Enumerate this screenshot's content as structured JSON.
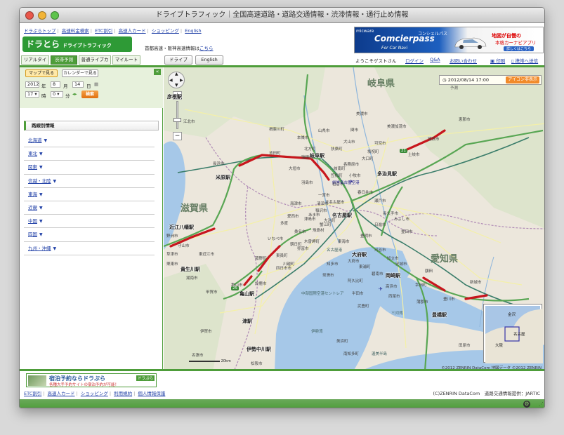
{
  "window": {
    "title": "ドライブトラフィック｜全国高速道路・道路交通情報・渋滞情報・通行止め情報"
  },
  "header": {
    "top_links": [
      "ドラぷらトップ",
      "高速料金検索",
      "ETC割引",
      "高速人カード",
      "ショッピング",
      "English"
    ],
    "logo_main": "ドラとら",
    "logo_sub": "ドライブトラフィック",
    "metro_text": "首都高速・阪神高速情報は",
    "metro_link": "こちら",
    "banner": {
      "brand": "micware",
      "product": "Comcierpass",
      "product_kana": "コンシェルパス",
      "tagline": "For Car Navi",
      "headline": "地図が自慢の",
      "subline": "本格カーナビアプリ",
      "cta": "詳しくはこちら"
    },
    "tabs": [
      "リアルタイム",
      "渋滞予測",
      "普通ライブカメラ",
      "マイルート"
    ],
    "active_tab": "渋滞予測",
    "view_buttons": [
      "ドライブ",
      "English"
    ],
    "greeting": "ようこそゲストさん",
    "user_links": [
      "ログイン",
      "Q&A",
      "お問い合わせ",
      "印刷",
      "携帯へ送信"
    ]
  },
  "sidebar": {
    "btn_map": "マップで見る",
    "btn_calendar": "カレンダーで見る",
    "year": "2012",
    "year_label": "年",
    "month": "8",
    "month_label": "月",
    "day": "14",
    "day_label": "日",
    "hour": "17",
    "hour_label": "時",
    "minute": "0",
    "minute_label": "分",
    "search_label": "検索",
    "collapse": "«",
    "section_title": "路線別情報",
    "regions": [
      "北海道",
      "東北",
      "関東",
      "信越・北陸",
      "東海",
      "近畿",
      "中国",
      "四国",
      "九州・沖縄"
    ],
    "region_arrow": "▼"
  },
  "map": {
    "datetime": "2012/08/14 17:00",
    "datetime_sub": "予測",
    "icon_toggle": "アイコン非表示",
    "prefectures": [
      "岐阜県",
      "滋賀県",
      "愛知県"
    ],
    "stations": [
      "名古屋駅",
      "岐阜駅",
      "多治見駅",
      "大府駅",
      "亀山駅",
      "津駅",
      "豊橋駅",
      "岡崎駅",
      "米原駅",
      "近江八幡駅",
      "貴生川駅",
      "伊勢中川駅",
      "彦根駅"
    ],
    "cities": [
      "長浜市",
      "江北市",
      "関市",
      "美濃市",
      "大垣市",
      "一宮市",
      "海津市",
      "桑名市",
      "四日市市",
      "鈴鹿市",
      "豊田市",
      "刈谷市",
      "碧南市",
      "西尾市",
      "知多市",
      "常滑市",
      "瀬戸市",
      "春日井市",
      "犬山市",
      "可児市",
      "東近江市",
      "甲賀市",
      "伊賀市",
      "松阪市",
      "安城市",
      "名張市",
      "蒲郡市",
      "新城市",
      "豊川市",
      "恵那市",
      "瑞浪市",
      "土岐市",
      "美濃加茂市",
      "各務原市",
      "羽島市",
      "稲沢市",
      "津島市",
      "愛西市",
      "弥富市",
      "いなべ市",
      "東海市",
      "半田市",
      "田原市",
      "日進市",
      "豊明市",
      "みよし市",
      "長久手市",
      "岩倉市",
      "北名古屋市",
      "清須市",
      "小牧市",
      "扶桑町",
      "守山市",
      "野洲市",
      "湖南市",
      "栗東市",
      "草津市",
      "亀山市",
      "高浜市",
      "知立市",
      "大口町",
      "坂祝町",
      "池田町",
      "揖斐川町",
      "本巣市",
      "山県市",
      "瑞穂市",
      "北方町",
      "笠松町",
      "岐南町",
      "多度",
      "東員町",
      "菰野町",
      "朝日町",
      "川越町",
      "木曽岬町",
      "飛島村",
      "蟹江町",
      "大治町",
      "あま市",
      "幸田町",
      "額田",
      "美浜町",
      "南知多町",
      "武豊町",
      "阿久比町",
      "東浦町",
      "大府市"
    ],
    "seas": [
      "中部国際空港セントレア",
      "名古屋港",
      "三河湾",
      "渥美半島",
      "伊勢湾"
    ],
    "airport": "県営名古屋空港",
    "route_numbers": [
      "21",
      "25"
    ],
    "scale_label": "20km",
    "copyright": "©2012 ZENRIN DataCom 地図データ ©2012 ZENRIN",
    "minimap": {
      "labels": [
        "金沢",
        "名古屋",
        "大阪"
      ]
    }
  },
  "footer": {
    "banner_title": "宿泊予約ならドラぷら",
    "banner_sub": "各種大手予約サイトの宿泊予約が可能！",
    "banner_badge": "ドラぷら",
    "links": [
      "ETC割引",
      "高速人カード",
      "ショッピング",
      "利用規約",
      "個人情報保護"
    ],
    "credit": "(C)ZENRIN DataCom　道路交通情報提供：JARTIC"
  },
  "colors": {
    "brand_green": "#4e9d3a",
    "congestion_red": "#c8161d",
    "accent_orange": "#f18a2a",
    "link_blue": "#1f3fa6"
  }
}
